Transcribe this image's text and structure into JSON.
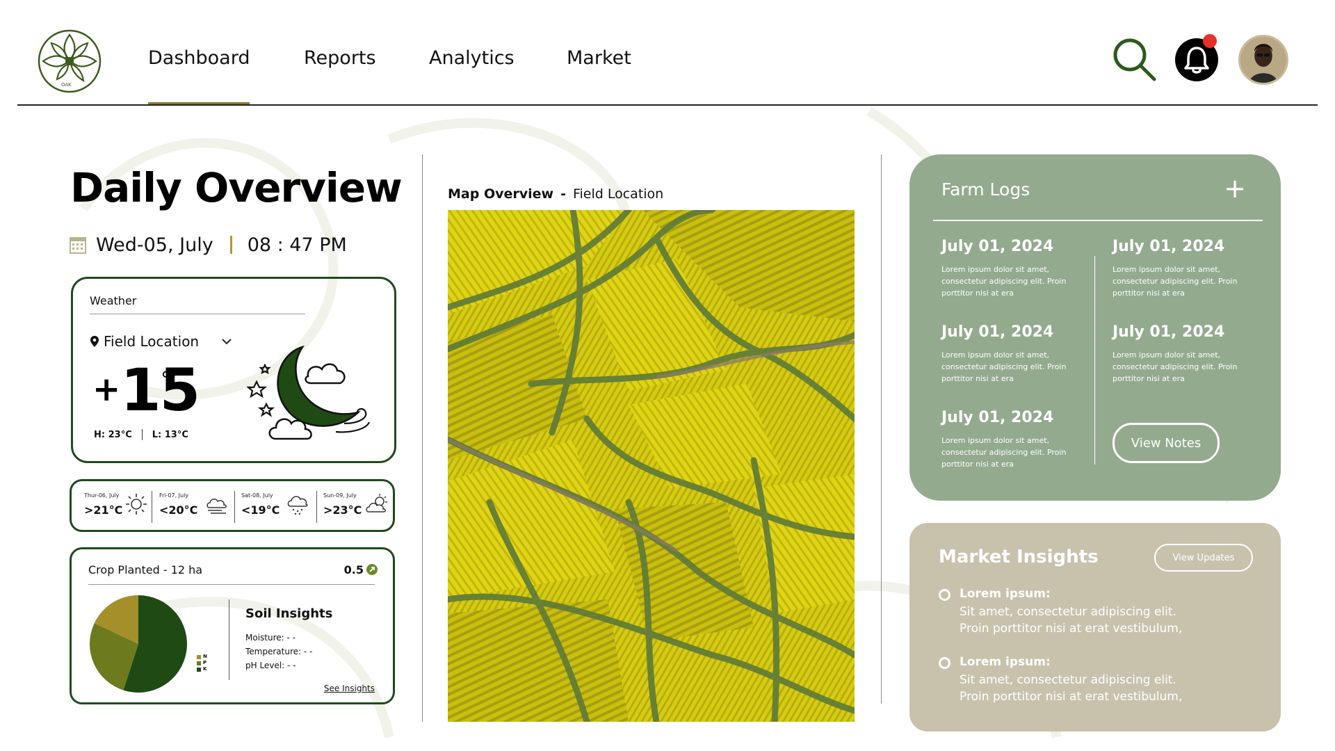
{
  "nav": {
    "items": [
      {
        "label": "Dashboard",
        "active": true
      },
      {
        "label": "Reports",
        "active": false
      },
      {
        "label": "Analytics",
        "active": false
      },
      {
        "label": "Market",
        "active": false
      }
    ],
    "logo_icon": "leaf-wreath-logo",
    "logo_text": "OAK"
  },
  "overview": {
    "title": "Daily Overview",
    "date": "Wed-05, July",
    "time": "08 : 47 PM"
  },
  "weather": {
    "label": "Weather",
    "location": "Field Location",
    "temp_sign": "+",
    "temp": "15",
    "unit": "°C",
    "high": "H: 23°C",
    "low": "L: 13°C",
    "forecast": [
      {
        "day": "Thur-06, July",
        "temp": ">21°C",
        "icon": "sun-icon"
      },
      {
        "day": "Fri-07, July",
        "temp": "<20°C",
        "icon": "windy-cloud-icon"
      },
      {
        "day": "Sat-08, July",
        "temp": "<19°C",
        "icon": "rain-cloud-icon"
      },
      {
        "day": "Sun-09, July",
        "temp": ">23°C",
        "icon": "partly-cloudy-icon"
      }
    ]
  },
  "crop": {
    "label": "Crop Planted - 12 ha",
    "value": "0.5",
    "npk": {
      "values": [
        0.55,
        0.27,
        0.18
      ],
      "legend": [
        "N",
        "P",
        "K"
      ],
      "colors": [
        "#1f4a14",
        "#6d7a1e",
        "#a48f2a"
      ]
    },
    "soil": {
      "title": "Soil Insights",
      "moisture": "Moisture:  - -",
      "temperature": "Temperature:  - -",
      "ph": "pH Level:  - -"
    },
    "link": "See Insights"
  },
  "map": {
    "title": "Map Overview",
    "subtitle": "Field Location"
  },
  "logs": {
    "title": "Farm Logs",
    "add": "+",
    "entries": [
      {
        "date": "July 01, 2024",
        "text": "Lorem ipsum dolor sit amet, consectetur adipiscing elit. Proin porttitor nisi at era"
      },
      {
        "date": "July 01, 2024",
        "text": "Lorem ipsum dolor sit amet, consectetur adipiscing elit. Proin porttitor nisi at era"
      },
      {
        "date": "July 01, 2024",
        "text": "Lorem ipsum dolor sit amet, consectetur adipiscing elit. Proin porttitor nisi at era"
      },
      {
        "date": "July 01, 2024",
        "text": "Lorem ipsum dolor sit amet, consectetur adipiscing elit. Proin porttitor nisi at era"
      },
      {
        "date": "July 01, 2024",
        "text": "Lorem ipsum dolor sit amet, consectetur adipiscing elit. Proin porttitor nisi at era"
      }
    ],
    "button": "View Notes"
  },
  "market": {
    "title": "Market Insights",
    "button": "View Updates",
    "items": [
      {
        "head": "Lorem ipsum:",
        "line1": "Sit amet, consectetur adipiscing elit.",
        "line2": "Proin porttitor nisi at erat vestibulum,"
      },
      {
        "head": "Lorem ipsum:",
        "line1": "Sit amet, consectetur adipiscing elit.",
        "line2": "Proin porttitor nisi at erat vestibulum,"
      }
    ]
  },
  "colors": {
    "brand_dark_green": "#1f4a1f",
    "nav_underline": "#8a7a2a",
    "logs_bg": "#94aa8f",
    "market_bg": "#c8c2ad",
    "notification": "#e8302a"
  }
}
